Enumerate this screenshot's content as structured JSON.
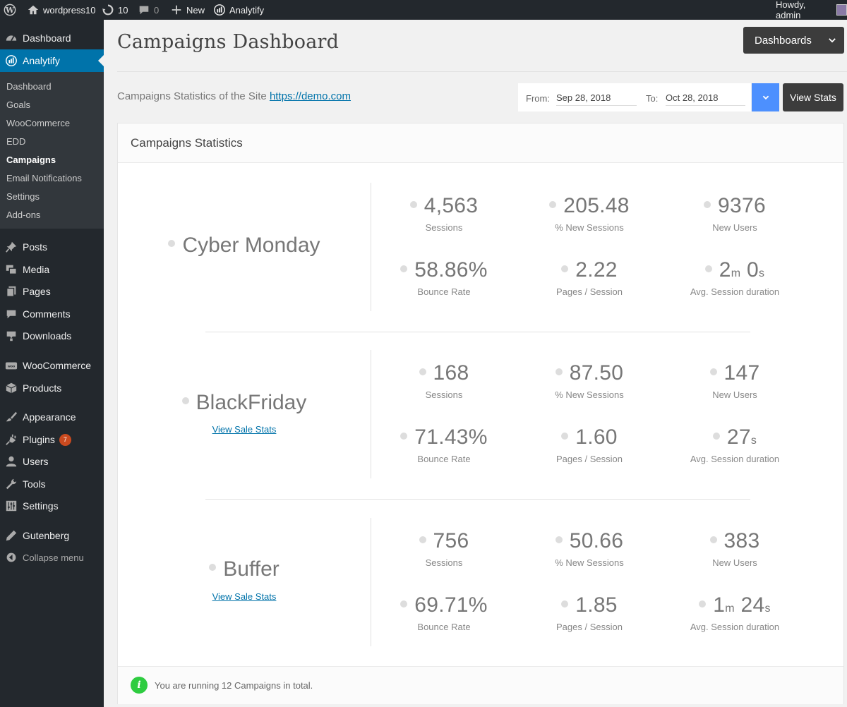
{
  "adminbar": {
    "site_name": "wordpress10",
    "updates_count": "10",
    "comments_count": "0",
    "new_label": "New",
    "plugin_label": "Analytify",
    "howdy": "Howdy, admin"
  },
  "sidebar": {
    "dashboard": "Dashboard",
    "analytify": "Analytify",
    "submenu": [
      "Dashboard",
      "Goals",
      "WooCommerce",
      "EDD",
      "Campaigns",
      "Email Notifications",
      "Settings",
      "Add-ons"
    ],
    "posts": "Posts",
    "media": "Media",
    "pages": "Pages",
    "comments": "Comments",
    "downloads": "Downloads",
    "woocommerce": "WooCommerce",
    "products": "Products",
    "appearance": "Appearance",
    "plugins": "Plugins",
    "plugins_badge": "7",
    "users": "Users",
    "tools": "Tools",
    "settings": "Settings",
    "gutenberg": "Gutenberg",
    "collapse": "Collapse menu"
  },
  "header": {
    "title": "Campaigns Dashboard",
    "dashboards_button": "Dashboards",
    "subtitle_prefix": "Campaigns Statistics of the Site",
    "site_url": "https://demo.com"
  },
  "date_range": {
    "from_label": "From:",
    "from_value": "Sep 28, 2018",
    "to_label": "To:",
    "to_value": "Oct 28, 2018",
    "view_stats": "View Stats"
  },
  "panel": {
    "title": "Campaigns Statistics",
    "footer": "You are running 12 Campaigns in total."
  },
  "labels": {
    "sessions": "Sessions",
    "new_sessions": "% New Sessions",
    "new_users": "New Users",
    "bounce_rate": "Bounce Rate",
    "pages_session": "Pages / Session",
    "avg_duration": "Avg. Session duration",
    "view_sale_stats": "View Sale Stats"
  },
  "campaigns": [
    {
      "name": "Cyber Monday",
      "sessions": "4,563",
      "new_sessions": "205.48",
      "new_users": "9376",
      "bounce_rate": "58.86%",
      "pages_session": "2.22",
      "dur_min": "2",
      "dur_min_unit": "m",
      "dur_sec": "0",
      "dur_sec_unit": "s"
    },
    {
      "name": "BlackFriday",
      "sessions": "168",
      "new_sessions": "87.50",
      "new_users": "147",
      "bounce_rate": "71.43%",
      "pages_session": "1.60",
      "dur_sec": "27",
      "dur_sec_unit": "s"
    },
    {
      "name": "Buffer",
      "sessions": "756",
      "new_sessions": "50.66",
      "new_users": "383",
      "bounce_rate": "69.71%",
      "pages_session": "1.85",
      "dur_min": "1",
      "dur_min_unit": "m",
      "dur_sec": "24",
      "dur_sec_unit": "s"
    }
  ]
}
